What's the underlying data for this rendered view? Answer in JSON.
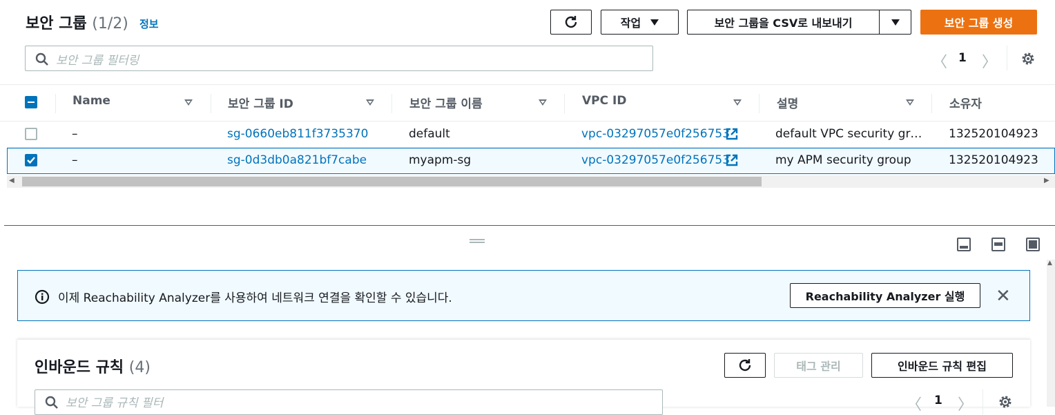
{
  "header": {
    "title": "보안 그룹",
    "count": "(1/2)",
    "info_link": "정보",
    "refresh_icon": "refresh-icon",
    "actions_label": "작업",
    "export_label": "보안 그룹을 CSV로 내보내기",
    "create_label": "보안 그룹 생성"
  },
  "search": {
    "placeholder": "보안 그룹 필터링"
  },
  "pagination": {
    "page": "1"
  },
  "table": {
    "columns": [
      "Name",
      "보안 그룹 ID",
      "보안 그룹 이름",
      "VPC ID",
      "설명",
      "소유자"
    ],
    "rows": [
      {
        "checked": false,
        "name": "–",
        "sg_id": "sg-0660eb811f3735370",
        "sg_name": "default",
        "vpc_id": "vpc-03297057e0f256753",
        "desc": "default VPC security gr…",
        "owner": "132520104923"
      },
      {
        "checked": true,
        "name": "–",
        "sg_id": "sg-0d3db0a821bf7cabe",
        "sg_name": "myapm-sg",
        "vpc_id": "vpc-03297057e0f256753",
        "desc": "my APM security group",
        "owner": "132520104923"
      }
    ]
  },
  "banner": {
    "text": "이제 Reachability Analyzer를 사용하여 네트워크 연결을 확인할 수 있습니다.",
    "button": "Reachability Analyzer 실행"
  },
  "inbound": {
    "title": "인바운드 규칙",
    "count": "(4)",
    "manage_tags": "태그 관리",
    "edit_label": "인바운드 규칙 편집",
    "search_placeholder": "보안 그룹 규칙 필터",
    "page": "1"
  },
  "colors": {
    "accent": "#ec7211",
    "link": "#0073bb",
    "info_bg": "#f1faff",
    "info_border": "#0073bb"
  }
}
